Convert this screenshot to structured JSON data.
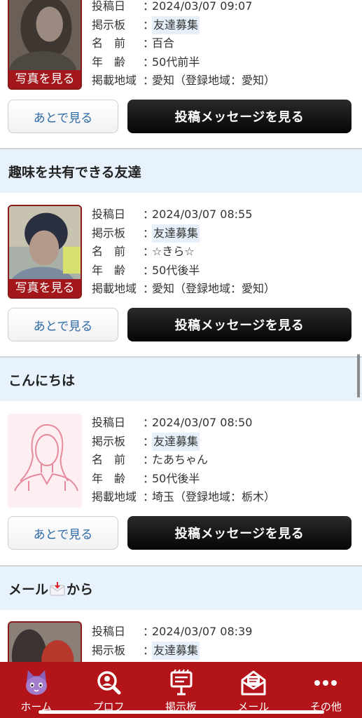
{
  "labels": {
    "posted": "投稿日",
    "board": "掲示板",
    "name": "名　前",
    "age": "年　齢",
    "area": "掲載地域",
    "sep": "：",
    "photo": "写真を見る",
    "later": "あとで見る",
    "view": "投稿メッセージを見る"
  },
  "posts": [
    {
      "date": "2024/03/07 09:07",
      "board": "友達募集",
      "name": "百合",
      "age": "50代前半",
      "area": "愛知（登録地域：愛知）",
      "has_photo": true
    },
    {
      "title": "趣味を共有できる友達",
      "date": "2024/03/07 08:55",
      "board": "友達募集",
      "name": "☆きら☆",
      "age": "50代後半",
      "area": "愛知（登録地域：愛知）",
      "has_photo": true
    },
    {
      "title": "こんにちは",
      "date": "2024/03/07 08:50",
      "board": "友達募集",
      "name": "たあちゃん",
      "age": "50代後半",
      "area": "埼玉（登録地域：栃木）",
      "has_photo": false
    },
    {
      "title_prefix": "メール",
      "title_suffix": "から",
      "title_icon": "envelope-emoji-icon",
      "date": "2024/03/07 08:39",
      "board": "友達募集",
      "has_photo": true
    }
  ],
  "tabbar": {
    "items": [
      {
        "label": "ホーム",
        "icon": "cat-mascot-icon"
      },
      {
        "label": "プロフ",
        "icon": "search-icon"
      },
      {
        "label": "掲示板",
        "icon": "bulletin-board-icon"
      },
      {
        "label": "メール",
        "icon": "mail-icon"
      },
      {
        "label": "その他",
        "icon": "more-icon"
      }
    ]
  },
  "colors": {
    "brand_red": "#b3141a",
    "header_blue": "#e7f2fc",
    "link_blue": "#2e6aa8"
  }
}
